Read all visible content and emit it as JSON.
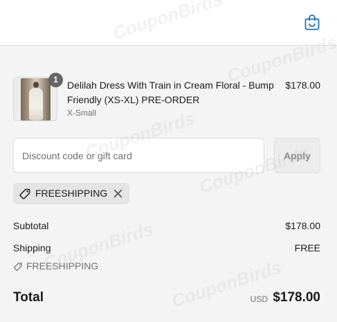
{
  "header": {
    "cart_icon": "shopping-bag-icon"
  },
  "product": {
    "title": "Delilah Dress With Train in Cream Floral - Bump Friendly (XS-XL) PRE-ORDER",
    "variant": "X-Small",
    "price": "$178.00",
    "quantity": "1"
  },
  "discount": {
    "placeholder": "Discount code or gift card",
    "apply_label": "Apply",
    "applied_code": "FREESHIPPING"
  },
  "summary": {
    "subtotal_label": "Subtotal",
    "subtotal_value": "$178.00",
    "shipping_label": "Shipping",
    "shipping_value": "FREE",
    "shipping_code": "FREESHIPPING",
    "total_label": "Total",
    "total_currency": "USD",
    "total_value": "$178.00"
  },
  "watermark": "CouponBirds",
  "colors": {
    "accent": "#1773b0",
    "background": "#f4f4f4",
    "chip": "#e4e4e4"
  }
}
